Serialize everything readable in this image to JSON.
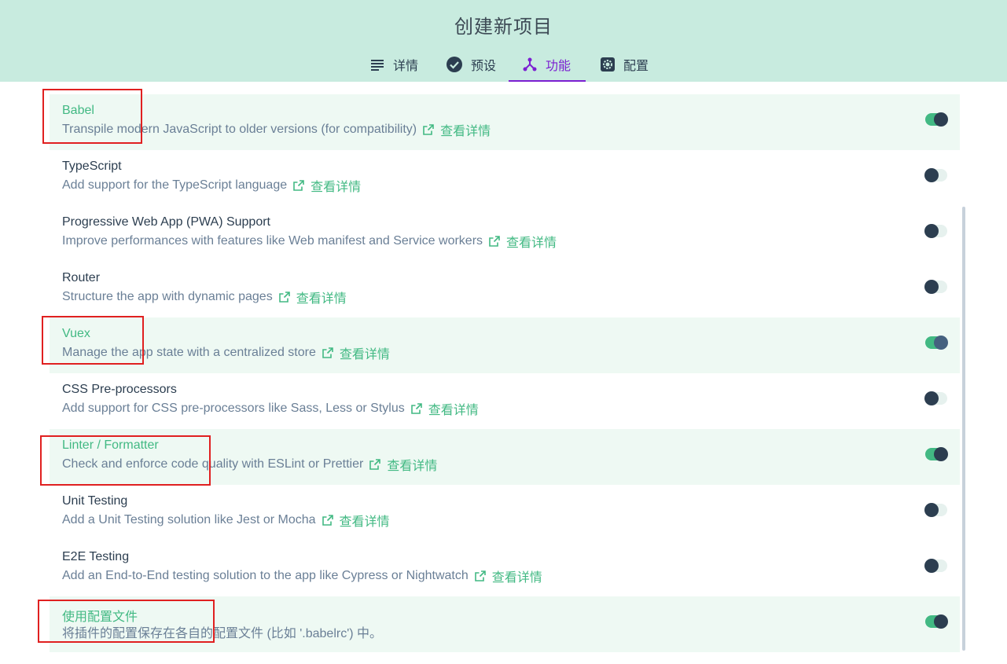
{
  "header": {
    "title": "创建新项目",
    "tabs": [
      {
        "label": "详情",
        "icon": "list-icon",
        "active": false
      },
      {
        "label": "预设",
        "icon": "check-circle-icon",
        "active": false
      },
      {
        "label": "功能",
        "icon": "fork-icon",
        "active": true
      },
      {
        "label": "配置",
        "icon": "gear-icon",
        "active": false
      }
    ]
  },
  "colors": {
    "header_bg": "#c8ebdf",
    "accent": "#42b983",
    "active_tab": "#7b1fd1",
    "selected_row_bg": "#eef9f3",
    "highlight_box": "#e02020"
  },
  "features": [
    {
      "name": "Babel",
      "description": "Transpile modern JavaScript to older versions (for compatibility)",
      "link": "查看详情",
      "enabled": true
    },
    {
      "name": "TypeScript",
      "description": "Add support for the TypeScript language",
      "link": "查看详情",
      "enabled": false
    },
    {
      "name": "Progressive Web App (PWA) Support",
      "description": "Improve performances with features like Web manifest and Service workers",
      "link": "查看详情",
      "enabled": false
    },
    {
      "name": "Router",
      "description": "Structure the app with dynamic pages",
      "link": "查看详情",
      "enabled": false
    },
    {
      "name": "Vuex",
      "description": "Manage the app state with a centralized store",
      "link": "查看详情",
      "enabled": true
    },
    {
      "name": "CSS Pre-processors",
      "description": "Add support for CSS pre-processors like Sass, Less or Stylus",
      "link": "查看详情",
      "enabled": false
    },
    {
      "name": "Linter / Formatter",
      "description": "Check and enforce code quality with ESLint or Prettier",
      "link": "查看详情",
      "enabled": true
    },
    {
      "name": "Unit Testing",
      "description": "Add a Unit Testing solution like Jest or Mocha",
      "link": "查看详情",
      "enabled": false
    },
    {
      "name": "E2E Testing",
      "description": "Add an End-to-End testing solution to the app like Cypress or Nightwatch",
      "link": "查看详情",
      "enabled": false
    },
    {
      "name": "使用配置文件",
      "description": "将插件的配置保存在各自的配置文件 (比如 '.babelrc') 中。",
      "link": "",
      "enabled": true
    }
  ]
}
